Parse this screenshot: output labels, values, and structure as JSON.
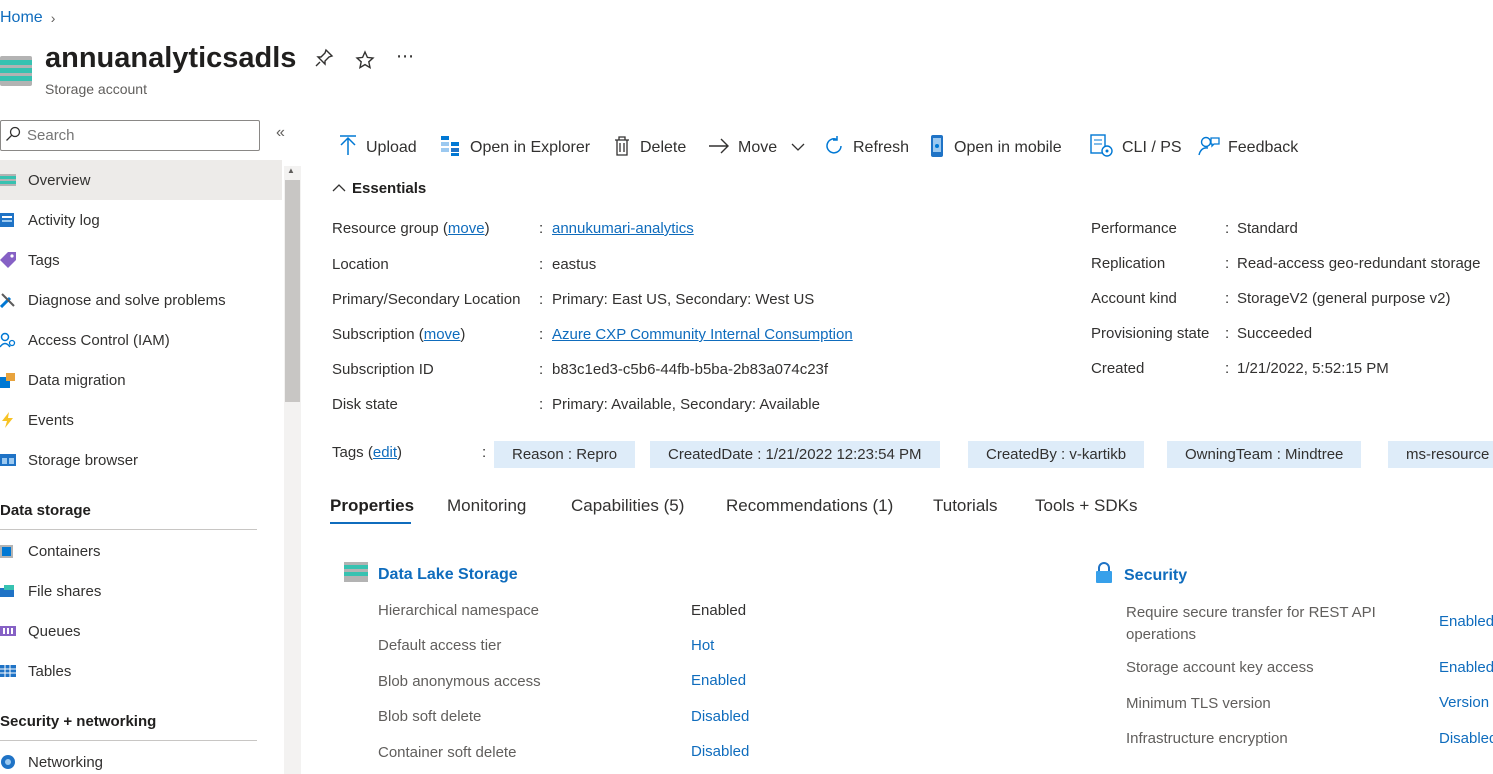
{
  "breadcrumb": {
    "home": "Home"
  },
  "resource": {
    "name": "annuanalyticsadls",
    "type": "Storage account"
  },
  "sidebar": {
    "search_placeholder": "Search",
    "items": [
      {
        "label": "Overview",
        "icon": "overview-icon"
      },
      {
        "label": "Activity log",
        "icon": "activity-log-icon"
      },
      {
        "label": "Tags",
        "icon": "tag-icon"
      },
      {
        "label": "Diagnose and solve problems",
        "icon": "wrench-icon"
      },
      {
        "label": "Access Control (IAM)",
        "icon": "people-icon"
      },
      {
        "label": "Data migration",
        "icon": "data-migration-icon"
      },
      {
        "label": "Events",
        "icon": "lightning-icon"
      },
      {
        "label": "Storage browser",
        "icon": "storage-browser-icon"
      }
    ],
    "section_data_storage": "Data storage",
    "data_storage_items": [
      {
        "label": "Containers",
        "icon": "containers-icon"
      },
      {
        "label": "File shares",
        "icon": "file-shares-icon"
      },
      {
        "label": "Queues",
        "icon": "queues-icon"
      },
      {
        "label": "Tables",
        "icon": "tables-icon"
      }
    ],
    "section_security": "Security + networking",
    "security_items": [
      {
        "label": "Networking",
        "icon": "networking-icon"
      }
    ]
  },
  "toolbar": {
    "upload": "Upload",
    "open_explorer": "Open in Explorer",
    "delete": "Delete",
    "move": "Move",
    "refresh": "Refresh",
    "open_mobile": "Open in mobile",
    "cli_ps": "CLI / PS",
    "feedback": "Feedback"
  },
  "essentials": {
    "title": "Essentials",
    "move_link": "move",
    "left": [
      {
        "label": "Resource group (",
        "value": "annukumari-analytics"
      },
      {
        "label": "Location",
        "value": "eastus"
      },
      {
        "label": "Primary/Secondary Location",
        "value": "Primary: East US, Secondary: West US"
      },
      {
        "label": "Subscription (",
        "value": "Azure CXP Community Internal Consumption"
      },
      {
        "label": "Subscription ID",
        "value": "b83c1ed3-c5b6-44fb-b5ba-2b83a074c23f"
      },
      {
        "label": "Disk state",
        "value": "Primary: Available, Secondary: Available"
      }
    ],
    "right": [
      {
        "label": "Performance",
        "value": "Standard"
      },
      {
        "label": "Replication",
        "value": "Read-access geo-redundant storage"
      },
      {
        "label": "Account kind",
        "value": "StorageV2 (general purpose v2)"
      },
      {
        "label": "Provisioning state",
        "value": "Succeeded"
      },
      {
        "label": "Created",
        "value": "1/21/2022, 5:52:15 PM"
      }
    ],
    "colon": ":",
    "close_paren": ")",
    "tags_label": "Tags (",
    "tags_edit": "edit",
    "tags": [
      "Reason : Repro",
      "CreatedDate : 1/21/2022 12:23:54 PM",
      "CreatedBy : v-kartikb",
      "OwningTeam : Mindtree",
      "ms-resource"
    ]
  },
  "tabs": [
    "Properties",
    "Monitoring",
    "Capabilities (5)",
    "Recommendations (1)",
    "Tutorials",
    "Tools + SDKs"
  ],
  "properties": {
    "data_lake": {
      "title": "Data Lake Storage",
      "rows": [
        {
          "label": "Hierarchical namespace",
          "value": "Enabled"
        },
        {
          "label": "Default access tier",
          "value": "Hot"
        },
        {
          "label": "Blob anonymous access",
          "value": "Enabled"
        },
        {
          "label": "Blob soft delete",
          "value": "Disabled"
        },
        {
          "label": "Container soft delete",
          "value": "Disabled"
        }
      ]
    },
    "security": {
      "title": "Security",
      "rows": [
        {
          "label_line1": "Require secure transfer for REST API",
          "label_line2": "operations",
          "value": "Enabled"
        },
        {
          "label": "Storage account key access",
          "value": "Enabled"
        },
        {
          "label": "Minimum TLS version",
          "value": "Version"
        },
        {
          "label": "Infrastructure encryption",
          "value": "Disabled"
        }
      ]
    }
  },
  "colors": {
    "accent": "#0f6cbd",
    "active_nav": "#edebe9",
    "tag_bg": "#deecf9"
  }
}
